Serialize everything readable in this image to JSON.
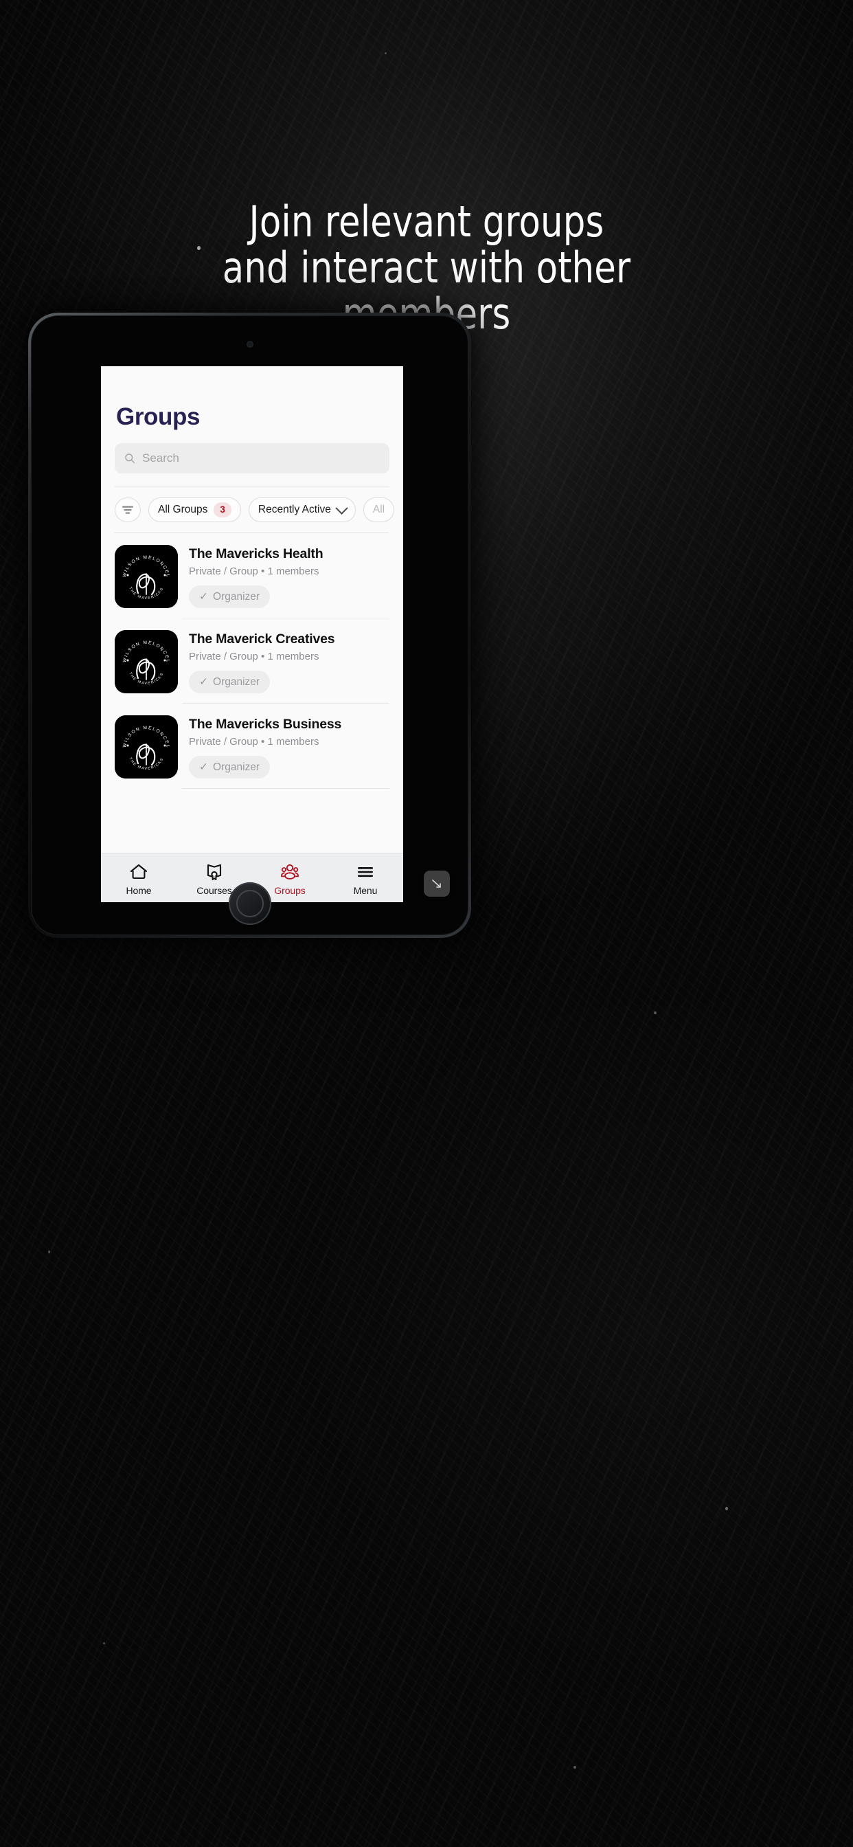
{
  "headline": {
    "lines": [
      "Join relevant groups",
      "and interact with other",
      "members"
    ]
  },
  "colors": {
    "background": "#0b0b0b",
    "headline_text": "#ffffff",
    "page_title": "#272252",
    "accent_red": "#b51221",
    "badge_bg": "#f6e1e2",
    "screen_bg": "#fafafa",
    "nav_bg": "#eceef0"
  },
  "app": {
    "page_title": "Groups",
    "search": {
      "placeholder": "Search",
      "value": "",
      "icon": "search-icon"
    },
    "filters": {
      "filter_icon": "filter-lines-icon",
      "chips": [
        {
          "label": "All Groups",
          "badge": "3",
          "has_chevron": false,
          "cut_off": false
        },
        {
          "label": "Recently Active",
          "badge": "",
          "has_chevron": true,
          "cut_off": false
        },
        {
          "label": "All",
          "badge": "",
          "has_chevron": false,
          "cut_off": true
        }
      ]
    },
    "groups": [
      {
        "name": "The Mavericks Health",
        "meta": "Private / Group  •  1 members",
        "role_badge": "Organizer",
        "role_check": "✓",
        "avatar_top_text": "C WILSON MELONCELLI",
        "avatar_bottom_text": "THE MAVERICKS"
      },
      {
        "name": "The Maverick Creatives",
        "meta": "Private / Group  •  1 members",
        "role_badge": "Organizer",
        "role_check": "✓",
        "avatar_top_text": "C WILSON MELONCELLI",
        "avatar_bottom_text": "THE MAVERICKS"
      },
      {
        "name": "The Mavericks Business",
        "meta": "Private / Group  •  1 members",
        "role_badge": "Organizer",
        "role_check": "✓",
        "avatar_top_text": "C WILSON MELONCELLI",
        "avatar_bottom_text": "THE MAVERICKS"
      }
    ],
    "bottom_nav": [
      {
        "label": "Home",
        "icon": "home-icon",
        "active": false
      },
      {
        "label": "Courses",
        "icon": "courses-icon",
        "active": false
      },
      {
        "label": "Groups",
        "icon": "groups-icon",
        "active": true
      },
      {
        "label": "Menu",
        "icon": "hamburger-icon",
        "active": false
      }
    ]
  },
  "overlay": {
    "resize_button_icon": "resize-arrow-icon"
  }
}
